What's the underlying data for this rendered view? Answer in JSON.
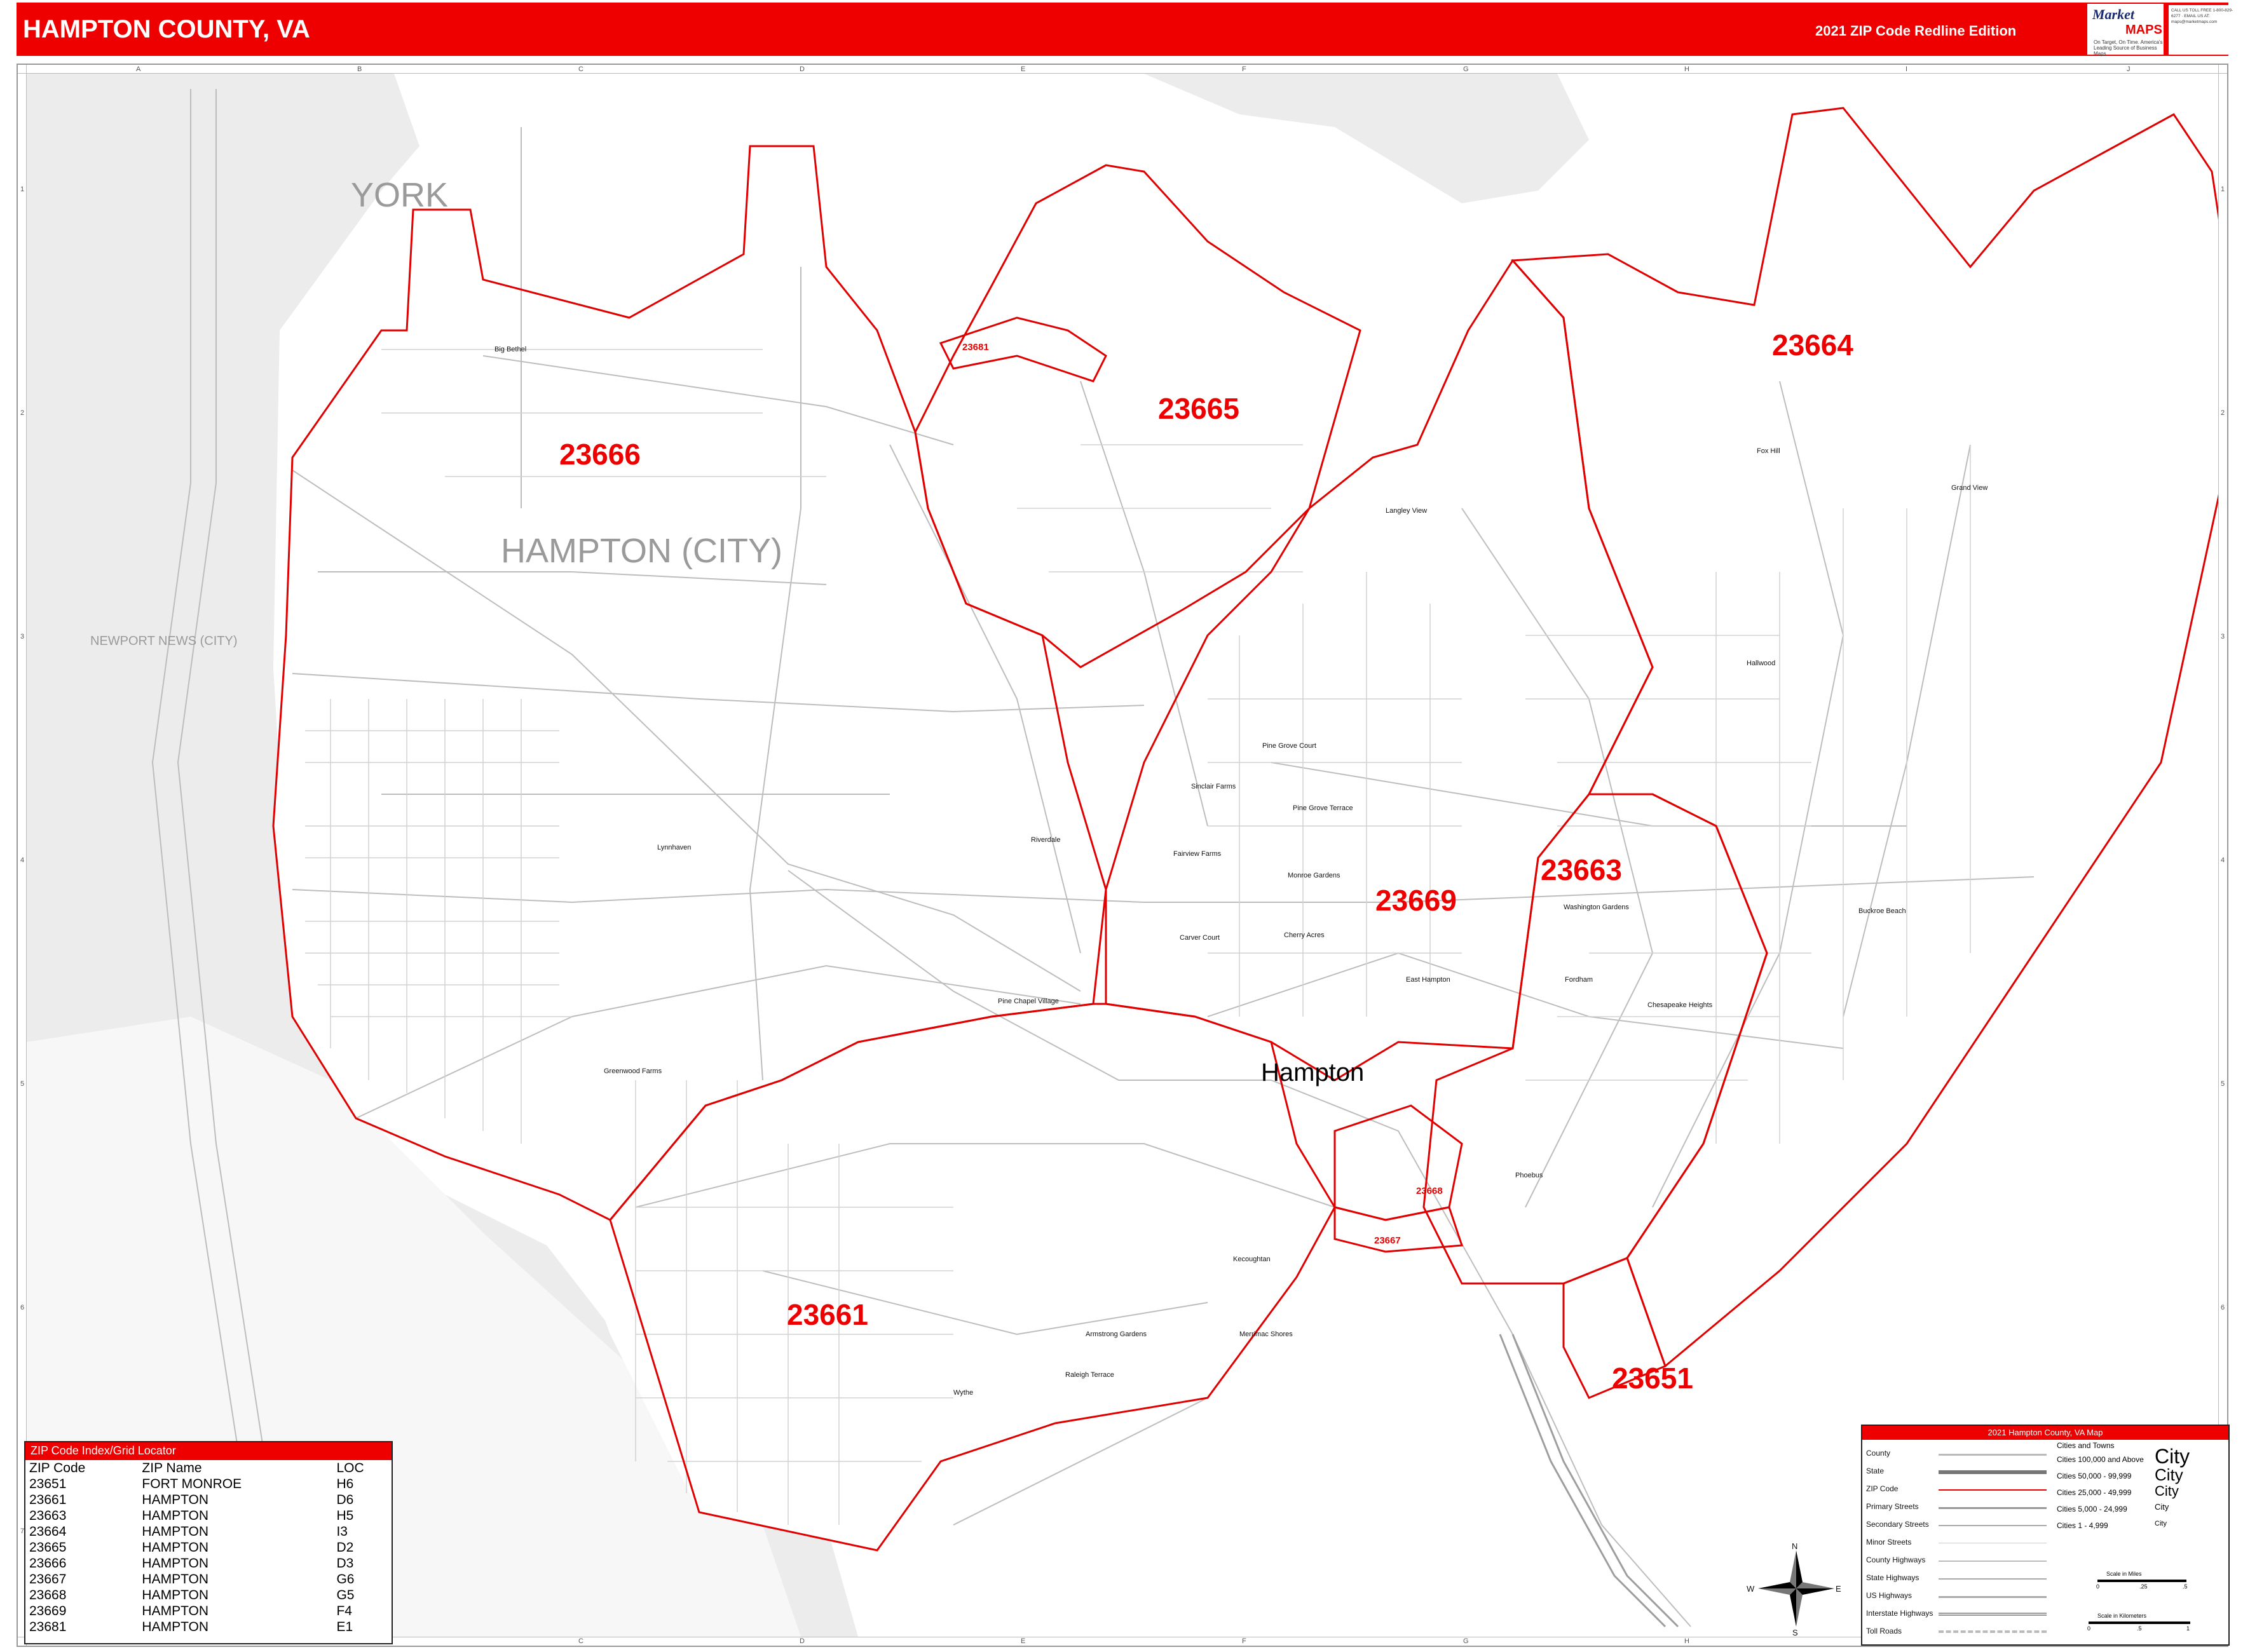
{
  "header": {
    "title": "HAMPTON COUNTY, VA",
    "edition": "2021 ZIP Code Redline Edition",
    "logo_line1": "Market",
    "logo_line2": "MAPS",
    "logo_tagline": "On Target, On Time. America's Leading Source of Business Maps",
    "contact": "CALL US TOLL FREE 1-800-829-6277 · EMAIL US AT: maps@marketmaps.com"
  },
  "grid": {
    "columns": [
      "A",
      "B",
      "C",
      "D",
      "E",
      "F",
      "G",
      "H",
      "I",
      "J"
    ],
    "rows": [
      "1",
      "2",
      "3",
      "4",
      "5",
      "6",
      "7"
    ]
  },
  "map": {
    "regions": {
      "york": "YORK",
      "hampton_city": "HAMPTON (CITY)",
      "newport_news": "NEWPORT NEWS (CITY)"
    },
    "main_city": "Hampton",
    "zips": {
      "z23651": "23651",
      "z23661": "23661",
      "z23663": "23663",
      "z23664": "23664",
      "z23665": "23665",
      "z23666": "23666",
      "z23667": "23667",
      "z23668": "23668",
      "z23669": "23669",
      "z23681": "23681"
    },
    "places": {
      "big_bethel": "Big Bethel",
      "fox_hill": "Fox Hill",
      "grand_view": "Grand View",
      "langley_view": "Langley View",
      "hallwood": "Hallwood",
      "pine_grove_court": "Pine Grove Court",
      "sinclair_farms": "Sinclair Farms",
      "pine_grove_terrace": "Pine Grove Terrace",
      "riverdale": "Riverdale",
      "lynnhaven": "Lynnhaven",
      "fairview_farms": "Fairview Farms",
      "monroe_gardens": "Monroe Gardens",
      "washington_gardens": "Washington Gardens",
      "buckroe_beach": "Buckroe Beach",
      "carver_court": "Carver Court",
      "cherry_acres": "Cherry Acres",
      "east_hampton": "East Hampton",
      "fordham": "Fordham",
      "chesapeake_heights": "Chesapeake Heights",
      "pine_chapel_village": "Pine Chapel Village",
      "greenwood_farms": "Greenwood Farms",
      "phoebus": "Phoebus",
      "kecoughtan": "Kecoughtan",
      "armstrong_gardens": "Armstrong Gardens",
      "merrimac_shores": "Merrimac Shores",
      "raleigh_terrace": "Raleigh Terrace",
      "wythe": "Wythe"
    },
    "compass": {
      "n": "N",
      "s": "S",
      "e": "E",
      "w": "W"
    }
  },
  "index": {
    "title": "ZIP Code Index/Grid Locator",
    "headers": [
      "ZIP Code",
      "ZIP Name",
      "LOC"
    ],
    "rows": [
      [
        "23651",
        "FORT MONROE",
        "H6"
      ],
      [
        "23661",
        "HAMPTON",
        "D6"
      ],
      [
        "23663",
        "HAMPTON",
        "H5"
      ],
      [
        "23664",
        "HAMPTON",
        "I3"
      ],
      [
        "23665",
        "HAMPTON",
        "D2"
      ],
      [
        "23666",
        "HAMPTON",
        "D3"
      ],
      [
        "23667",
        "HAMPTON",
        "G6"
      ],
      [
        "23668",
        "HAMPTON",
        "G5"
      ],
      [
        "23669",
        "HAMPTON",
        "F4"
      ],
      [
        "23681",
        "HAMPTON",
        "E1"
      ]
    ]
  },
  "legend": {
    "title": "2021 Hampton County, VA Map",
    "items": [
      "County",
      "State",
      "ZIP Code",
      "Primary Streets",
      "Secondary Streets",
      "Minor Streets",
      "County Highways",
      "State Highways",
      "US Highways",
      "Interstate Highways",
      "Toll Roads"
    ],
    "cities_title": "Cities and Towns",
    "cities": [
      "Cities 100,000 and Above",
      "Cities 50,000 - 99,999",
      "Cities 25,000 - 49,999",
      "Cities 5,000 - 24,999",
      "Cities 1 - 4,999"
    ],
    "city_sample": "City",
    "scale_miles": "Scale in Miles",
    "scale_km": "Scale in Kilometers",
    "scale_miles_ticks": [
      "0",
      ".25",
      ".5"
    ],
    "scale_km_ticks": [
      "0",
      ".5",
      "1"
    ]
  },
  "colors": {
    "accent": "#ee0000",
    "zip_boundary": "#e00000",
    "roads": "#b5b5b5",
    "land_outside": "#ececec"
  }
}
